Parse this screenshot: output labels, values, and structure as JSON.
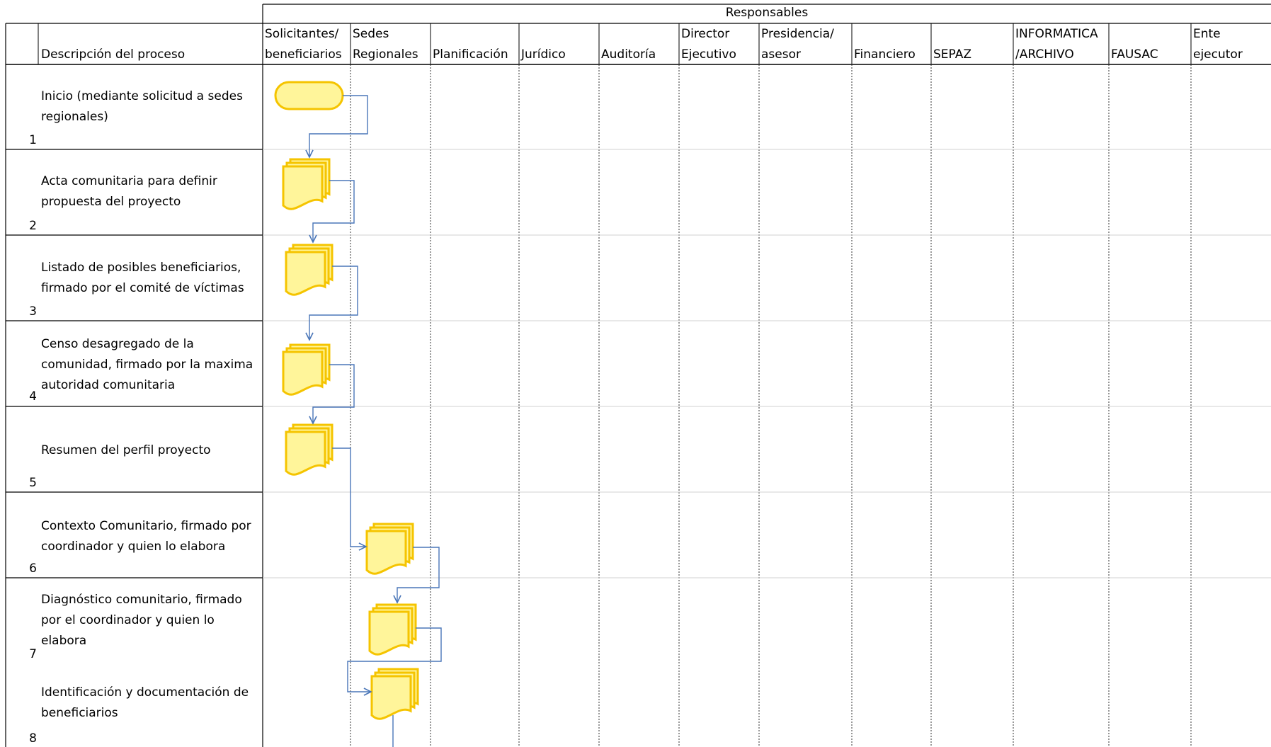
{
  "header": {
    "group_title": "Responsables",
    "description_header": "Descripción del proceso",
    "columns": [
      {
        "line1": "Solicitantes/",
        "line2": "beneficiarios"
      },
      {
        "line1": "Sedes",
        "line2": "Regionales"
      },
      {
        "line1": "",
        "line2": "Planificación"
      },
      {
        "line1": "",
        "line2": "Jurídico"
      },
      {
        "line1": "",
        "line2": "Auditoría"
      },
      {
        "line1": "Director",
        "line2": "Ejecutivo"
      },
      {
        "line1": "Presidencia/",
        "line2": "asesor"
      },
      {
        "line1": "",
        "line2": "Financiero"
      },
      {
        "line1": "",
        "line2": "SEPAZ"
      },
      {
        "line1": "INFORMATICA",
        "line2": "/ARCHIVO"
      },
      {
        "line1": "",
        "line2": "FAUSAC"
      },
      {
        "line1": "Ente",
        "line2": "ejecutor"
      }
    ]
  },
  "steps": [
    {
      "number": "1",
      "description": "Inicio (mediante solicitud a sedes regionales)",
      "shape": "terminator",
      "lane": "Solicitantes/ beneficiarios"
    },
    {
      "number": "2",
      "description": "Acta comunitaria para definir propuesta del proyecto",
      "shape": "multi-document",
      "lane": "Solicitantes/ beneficiarios"
    },
    {
      "number": "3",
      "description": "Listado de posibles beneficiarios, firmado por el comité de víctimas",
      "shape": "multi-document",
      "lane": "Solicitantes/ beneficiarios"
    },
    {
      "number": "4",
      "description": "Censo desagregado de la comunidad, firmado por la maxima autoridad comunitaria",
      "shape": "multi-document",
      "lane": "Solicitantes/ beneficiarios"
    },
    {
      "number": "5",
      "description": "Resumen del perfil proyecto",
      "shape": "multi-document",
      "lane": "Solicitantes/ beneficiarios"
    },
    {
      "number": "6",
      "description": "Contexto Comunitario, firmado por coordinador y quien lo elabora",
      "shape": "multi-document",
      "lane": "Sedes Regionales"
    },
    {
      "number": "7",
      "description": "Diagnóstico comunitario, firmado por el coordinador y quien lo elabora",
      "shape": "multi-document",
      "lane": "Sedes Regionales"
    },
    {
      "number": "8",
      "description": "Identificación y documentación de beneficiarios",
      "shape": "multi-document",
      "lane": "Sedes Regionales"
    }
  ],
  "colors": {
    "shape_fill": "#FFF59A",
    "shape_stroke": "#F5C400",
    "connector": "#4A76B8",
    "grid": "#000000",
    "row_divider": "#D0D0D0"
  }
}
